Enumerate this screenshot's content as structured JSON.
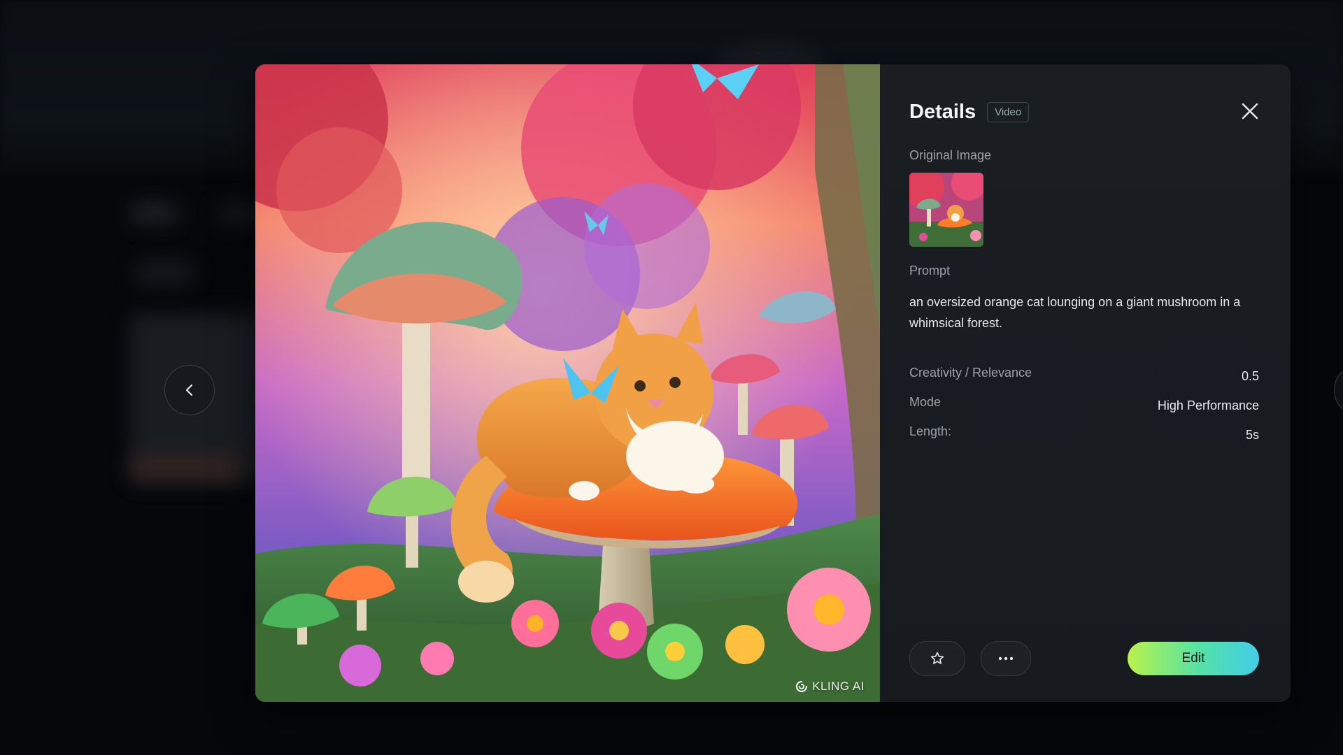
{
  "details": {
    "title": "Details",
    "badge": "Video",
    "original_image_label": "Original Image",
    "prompt_label": "Prompt",
    "prompt_text": "an oversized orange cat lounging on a giant mushroom in a whimsical forest.",
    "params": [
      {
        "label": "Creativity / Relevance",
        "value": "0.5"
      },
      {
        "label": "Mode",
        "value": "High Performance"
      },
      {
        "label": "Length:",
        "value": "5s"
      }
    ]
  },
  "media": {
    "watermark": "KLING AI"
  },
  "actions": {
    "edit_label": "Edit",
    "favorite_icon": "star-icon",
    "more_icon": "more-icon"
  },
  "icons": {
    "close": "close-icon",
    "prev": "chevron-left-icon",
    "next": "chevron-right-icon"
  },
  "colors": {
    "modal_bg": "#181c21",
    "edit_gradient_start": "#b9f24a",
    "edit_gradient_end": "#42cde8",
    "badge_text": "#8fb3a8"
  }
}
